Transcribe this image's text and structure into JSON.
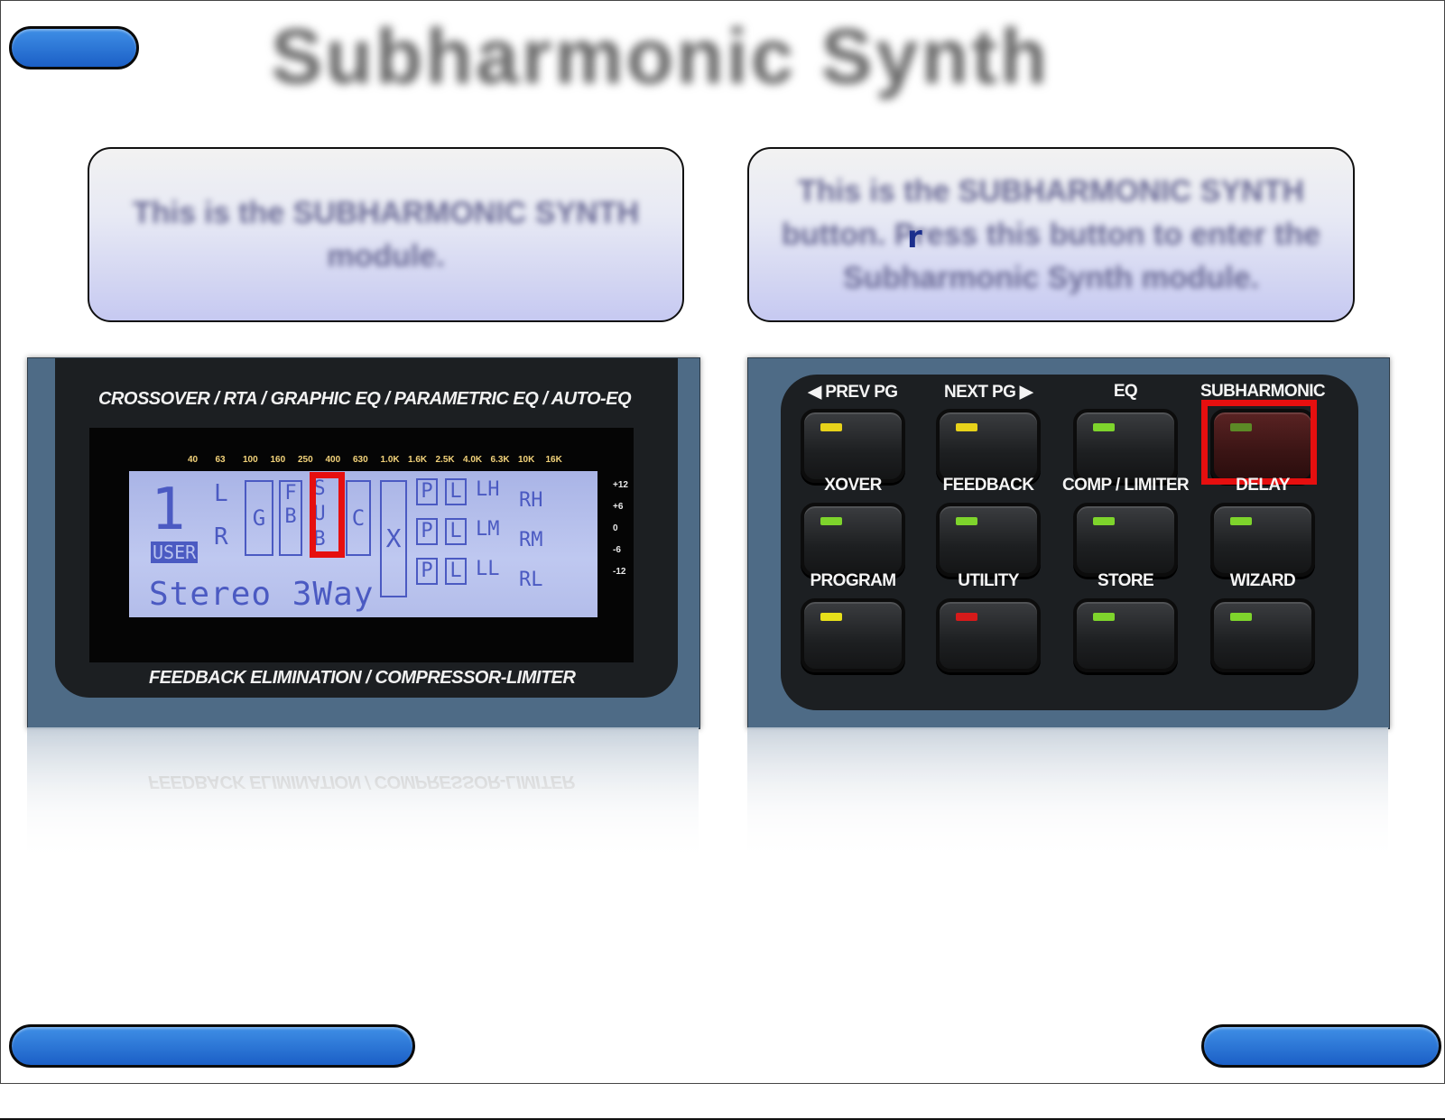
{
  "page": {
    "title": "Subharmonic Synth"
  },
  "nav": {
    "top_left_label": "",
    "bottom_left_label": "",
    "bottom_right_label": ""
  },
  "callouts": {
    "left": "This is the SUBHARMONIC SYNTH module.",
    "right": "This is the SUBHARMONIC SYNTH button. Press this button to enter the Subharmonic Synth module.",
    "cursor_char": "r"
  },
  "lcd_panel": {
    "top_caption": "CROSSOVER / RTA / GRAPHIC EQ / PARAMETRIC EQ / AUTO-EQ",
    "bottom_caption": "FEEDBACK ELIMINATION / COMPRESSOR-LIMITER",
    "freq_labels": [
      "40",
      "63",
      "100",
      "160",
      "250",
      "400",
      "630",
      "1.0K",
      "1.6K",
      "2.5K",
      "4.0K",
      "6.3K",
      "10K",
      "16K"
    ],
    "db_labels": [
      "+12",
      "+6",
      "0",
      "-6",
      "-12"
    ],
    "screen": {
      "program_number": "1",
      "user_badge": "USER",
      "input_left": "L",
      "input_right": "R",
      "block_g": "G",
      "block_fb": "F B",
      "block_sub": "S U B",
      "block_c": "C",
      "block_x": "X",
      "block_p": "P",
      "block_l": "L",
      "out_high_l": "LH",
      "out_mid_l": "LM",
      "out_low_l": "LL",
      "out_high_r": "RH",
      "out_mid_r": "RM",
      "out_low_r": "RL",
      "program_name": "Stereo 3Way"
    }
  },
  "button_panel": {
    "buttons": [
      {
        "label": "◀ PREV PG",
        "led": "#e7d21a"
      },
      {
        "label": "NEXT PG ▶",
        "led": "#e7d21a"
      },
      {
        "label": "EQ",
        "led": "#7ed42c"
      },
      {
        "label": "SUBHARMONIC",
        "led": "#5c8a26",
        "highlight": true
      },
      {
        "label": "XOVER",
        "led": "#7ed42c"
      },
      {
        "label": "FEEDBACK",
        "led": "#7ed42c"
      },
      {
        "label": "COMP / LIMITER",
        "led": "#7ed42c"
      },
      {
        "label": "DELAY",
        "led": "#7ed42c"
      },
      {
        "label": "PROGRAM",
        "led": "#e7e01a"
      },
      {
        "label": "UTILITY",
        "led": "#d61a1a"
      },
      {
        "label": "STORE",
        "led": "#7ed42c"
      },
      {
        "label": "WIZARD",
        "led": "#7ed42c"
      }
    ]
  },
  "colors": {
    "nav_button": "#2a75d8",
    "highlight": "#e60f0f",
    "panel_steel": "#4e6b86",
    "lcd_backlight": "#b7c1ee"
  }
}
